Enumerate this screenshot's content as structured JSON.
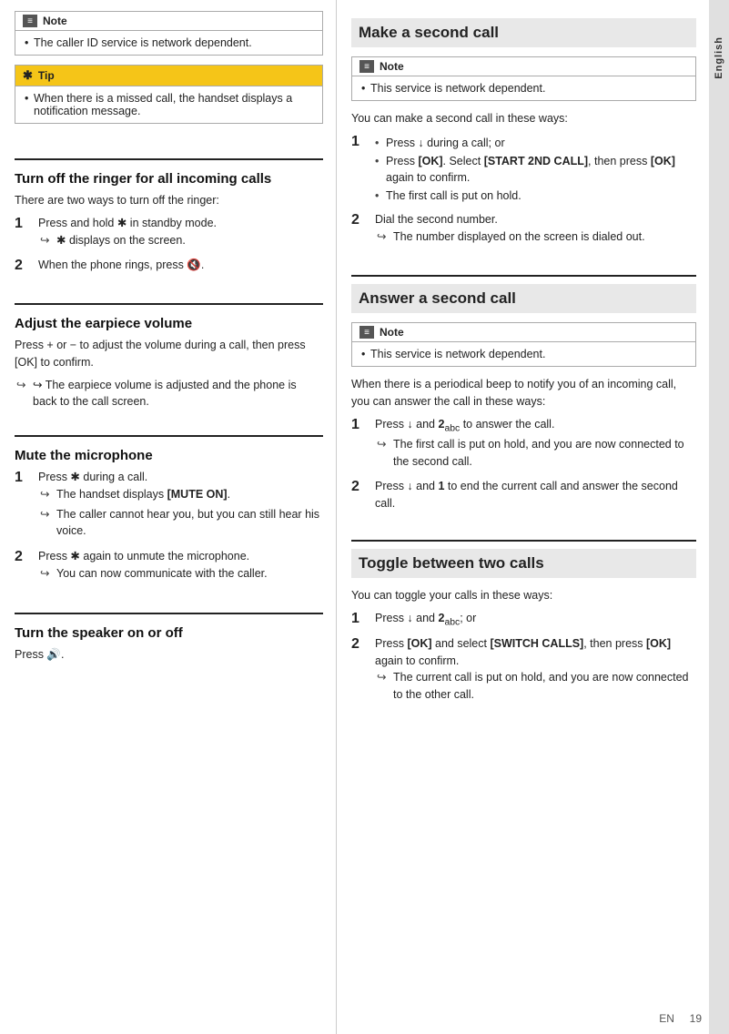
{
  "lang": {
    "label": "English"
  },
  "left_col": {
    "note1": {
      "header": "Note",
      "icon": "≡",
      "body": "The caller ID service is network dependent."
    },
    "tip1": {
      "header": "Tip",
      "body": "When there is a missed call, the handset displays a notification message."
    },
    "section1": {
      "title": "Turn off the ringer for all incoming calls",
      "intro": "There are two ways to turn off the ringer:",
      "steps": [
        {
          "num": "1",
          "text": "Press and hold ✱ in standby mode.",
          "sub": "↪ ✱ displays on the screen."
        },
        {
          "num": "2",
          "text": "When the phone rings, press 🔇."
        }
      ]
    },
    "section2": {
      "title": "Adjust the earpiece volume",
      "intro": "Press + or − to adjust the volume during a call, then press [OK] to confirm.",
      "sub": "↪ The earpiece volume is adjusted and the phone is back to the call screen."
    },
    "section3": {
      "title": "Mute the microphone",
      "steps": [
        {
          "num": "1",
          "text": "Press ✱ during a call.",
          "subs": [
            "The handset displays [MUTE ON].",
            "The caller cannot hear you, but you can still hear his voice."
          ]
        },
        {
          "num": "2",
          "text": "Press ✱ again to unmute the microphone.",
          "subs": [
            "You can now communicate with the caller."
          ]
        }
      ]
    },
    "section4": {
      "title": "Turn the speaker on or off",
      "intro": "Press 🔈."
    }
  },
  "right_col": {
    "section1": {
      "title": "Make a second call",
      "note": {
        "header": "Note",
        "body": "This service is network dependent."
      },
      "intro": "You can make a second call in these ways:",
      "steps": [
        {
          "num": "1",
          "bullets": [
            "Press ↓ during a call; or",
            "Press [OK]. Select [START 2ND CALL], then press [OK] again to confirm.",
            "The first call is put on hold."
          ]
        },
        {
          "num": "2",
          "text": "Dial the second number.",
          "sub": "The number displayed on the screen is dialed out."
        }
      ]
    },
    "section2": {
      "title": "Answer a second call",
      "note": {
        "header": "Note",
        "body": "This service is network dependent."
      },
      "intro": "When there is a periodical beep to notify you of an incoming call, you can answer the call in these ways:",
      "steps": [
        {
          "num": "1",
          "text": "Press ↓ and 2abc to answer the call.",
          "sub": "The first call is put on hold, and you are now connected to the second call."
        },
        {
          "num": "2",
          "text": "Press ↓ and 1 to end the current call and answer the second call."
        }
      ]
    },
    "section3": {
      "title": "Toggle between two calls",
      "intro": "You can toggle your calls in these ways:",
      "steps": [
        {
          "num": "1",
          "text": "Press ↓ and 2abc; or"
        },
        {
          "num": "2",
          "text": "Press [OK] and select [SWITCH CALLS], then press [OK] again to confirm.",
          "sub": "The current call is put on hold, and you are now connected to the other call."
        }
      ]
    }
  },
  "footer": {
    "lang_label": "EN",
    "page_num": "19"
  }
}
